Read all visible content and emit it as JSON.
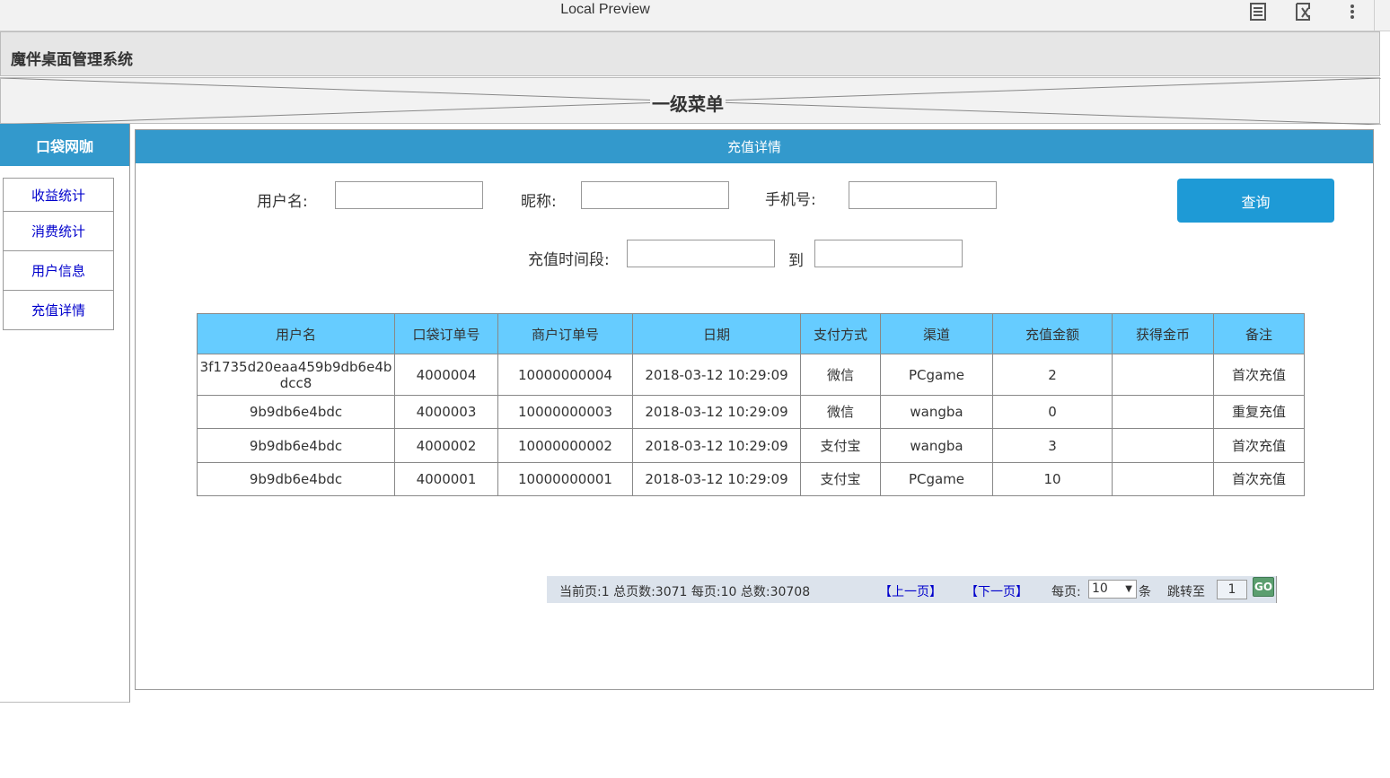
{
  "window": {
    "title": "Local Preview"
  },
  "header": {
    "title": "魔伴桌面管理系统"
  },
  "menu": {
    "title": "一级菜单"
  },
  "sidebar": {
    "title": "口袋网咖",
    "items": [
      {
        "label": "收益统计"
      },
      {
        "label": "消费统计"
      },
      {
        "label": "用户信息"
      },
      {
        "label": "充值详情"
      }
    ]
  },
  "panel": {
    "title": "充值详情"
  },
  "search": {
    "username_label": "用户名:",
    "nickname_label": "昵称:",
    "phone_label": "手机号:",
    "time_label": "充值时间段:",
    "to_label": "到",
    "query_label": "查询"
  },
  "table": {
    "headers": [
      "用户名",
      "口袋订单号",
      "商户订单号",
      "日期",
      "支付方式",
      "渠道",
      "充值金额",
      "获得金币",
      "备注"
    ],
    "rows": [
      [
        "3f1735d20eaa459b9db6e4bdcc8",
        "4000004",
        "10000000004",
        "2018-03-12 10:29:09",
        "微信",
        "PCgame",
        "2",
        "",
        "首次充值"
      ],
      [
        "9b9db6e4bdc",
        "4000003",
        "10000000003",
        "2018-03-12 10:29:09",
        "微信",
        "wangba",
        "0",
        "",
        "重复充值"
      ],
      [
        "9b9db6e4bdc",
        "4000002",
        "10000000002",
        "2018-03-12 10:29:09",
        "支付宝",
        "wangba",
        "3",
        "",
        "首次充值"
      ],
      [
        "9b9db6e4bdc",
        "4000001",
        "10000000001",
        "2018-03-12 10:29:09",
        "支付宝",
        "PCgame",
        "10",
        "",
        "首次充值"
      ]
    ]
  },
  "pager": {
    "summary": "当前页:1 总页数:3071 每页:10 总数:30708",
    "prev": "【上一页】",
    "next": "【下一页】",
    "per_page_label": "每页:",
    "per_page_value": "10",
    "unit": "条",
    "jump_label": "跳转至",
    "jump_value": "1",
    "go_label": "GO"
  },
  "icons": [
    "document-icon",
    "extension-x-icon",
    "more-vertical-icon",
    "dropdown-arrow-icon"
  ]
}
